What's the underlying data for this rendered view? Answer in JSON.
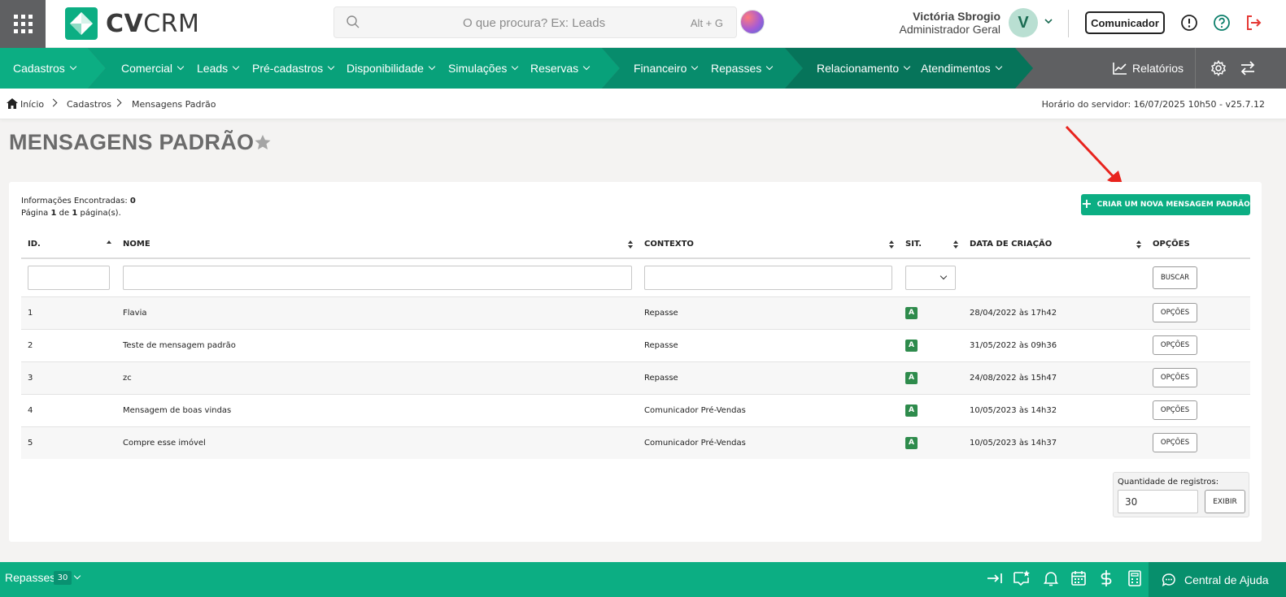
{
  "header": {
    "logo_text_bold": "CV",
    "logo_text_light": "CRM",
    "search_placeholder": "O que procura? Ex: Leads",
    "search_shortcut": "Alt + G",
    "user_name": "Victória Sbrogio",
    "user_role": "Administrador Geral",
    "avatar_letter": "V",
    "comunicador_label": "Comunicador",
    "brand_color": "#0cae83"
  },
  "nav": {
    "cadastros": "Cadastros",
    "comercial": "Comercial",
    "leads": "Leads",
    "pre_cadastros": "Pré-cadastros",
    "disponibilidade": "Disponibilidade",
    "simulacoes": "Simulações",
    "reservas": "Reservas",
    "financeiro": "Financeiro",
    "repasses": "Repasses",
    "relacionamento": "Relacionamento",
    "atendimentos": "Atendimentos",
    "relatorios": "Relatórios"
  },
  "breadcrumb": {
    "home": "Início",
    "level1": "Cadastros",
    "level2": "Mensagens Padrão",
    "server_time": "Horário do servidor: 16/07/2025 10h50 - v25.7.12"
  },
  "page": {
    "title": "MENSAGENS PADRÃO",
    "info_label": "Informações Encontradas:",
    "info_count": "0",
    "page_prefix": "Página",
    "page_current": "1",
    "page_of": "de",
    "page_total": "1",
    "page_suffix": "página(s).",
    "create_button": "CRIAR UM NOVA MENSAGEM PADRÃO"
  },
  "table": {
    "columns": [
      "ID.",
      "NOME",
      "CONTEXTO",
      "SIT.",
      "DATA DE CRIAÇÃO",
      "OPÇÕES"
    ],
    "search_button": "BUSCAR",
    "rows": [
      {
        "id": "1",
        "nome": "Flavia",
        "contexto": "Repasse",
        "sit": "A",
        "data": "28/04/2022 às 17h42",
        "opcoes": "OPÇÕES"
      },
      {
        "id": "2",
        "nome": "Teste de mensagem padrão",
        "contexto": "Repasse",
        "sit": "A",
        "data": "31/05/2022 às 09h36",
        "opcoes": "OPÇÕES"
      },
      {
        "id": "3",
        "nome": "zc",
        "contexto": "Repasse",
        "sit": "A",
        "data": "24/08/2022 às 15h47",
        "opcoes": "OPÇÕES"
      },
      {
        "id": "4",
        "nome": "Mensagem de boas vindas",
        "contexto": "Comunicador Pré-Vendas",
        "sit": "A",
        "data": "10/05/2023 às 14h32",
        "opcoes": "OPÇÕES"
      },
      {
        "id": "5",
        "nome": "Compre esse imóvel",
        "contexto": "Comunicador Pré-Vendas",
        "sit": "A",
        "data": "10/05/2023 às 14h37",
        "opcoes": "OPÇÕES"
      }
    ]
  },
  "pagination": {
    "qty_label": "Quantidade de registros:",
    "qty_value": "30",
    "show_button": "EXIBIR"
  },
  "bottom": {
    "module_label": "Repasses",
    "module_count": "30",
    "help_label": "Central de Ajuda"
  }
}
